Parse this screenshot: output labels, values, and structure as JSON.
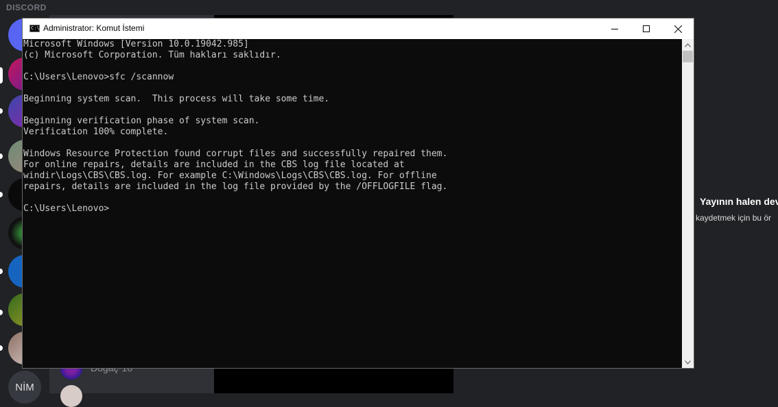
{
  "discord": {
    "app_name": "DISCORD",
    "guild_text_icon": "NİM",
    "dm_name": "Doğaç⁷10",
    "stream_title": "Yayının halen dev",
    "stream_subtitle": "kaydetmek için bu ör"
  },
  "cmd": {
    "title": "Administrator: Komut İstemi",
    "icon_text": "C:\\",
    "lines": [
      "Microsoft Windows [Version 10.0.19042.985]",
      "(c) Microsoft Corporation. Tüm hakları saklıdır.",
      "",
      "C:\\Users\\Lenovo>sfc /scannow",
      "",
      "Beginning system scan.  This process will take some time.",
      "",
      "Beginning verification phase of system scan.",
      "Verification 100% complete.",
      "",
      "Windows Resource Protection found corrupt files and successfully repaired them.",
      "For online repairs, details are included in the CBS log file located at",
      "windir\\Logs\\CBS\\CBS.log. For example C:\\Windows\\Logs\\CBS\\CBS.log. For offline",
      "repairs, details are included in the log file provided by the /OFFLOGFILE flag.",
      "",
      "C:\\Users\\Lenovo>"
    ],
    "buttons": {
      "minimize_icon": "minimize-icon",
      "maximize_icon": "maximize-icon",
      "close_icon": "close-icon"
    }
  },
  "colors": {
    "console_bg": "#0c0c0c",
    "console_text": "#cccccc",
    "discord_bg": "#202225",
    "discord_sidebar": "#2f3136"
  }
}
